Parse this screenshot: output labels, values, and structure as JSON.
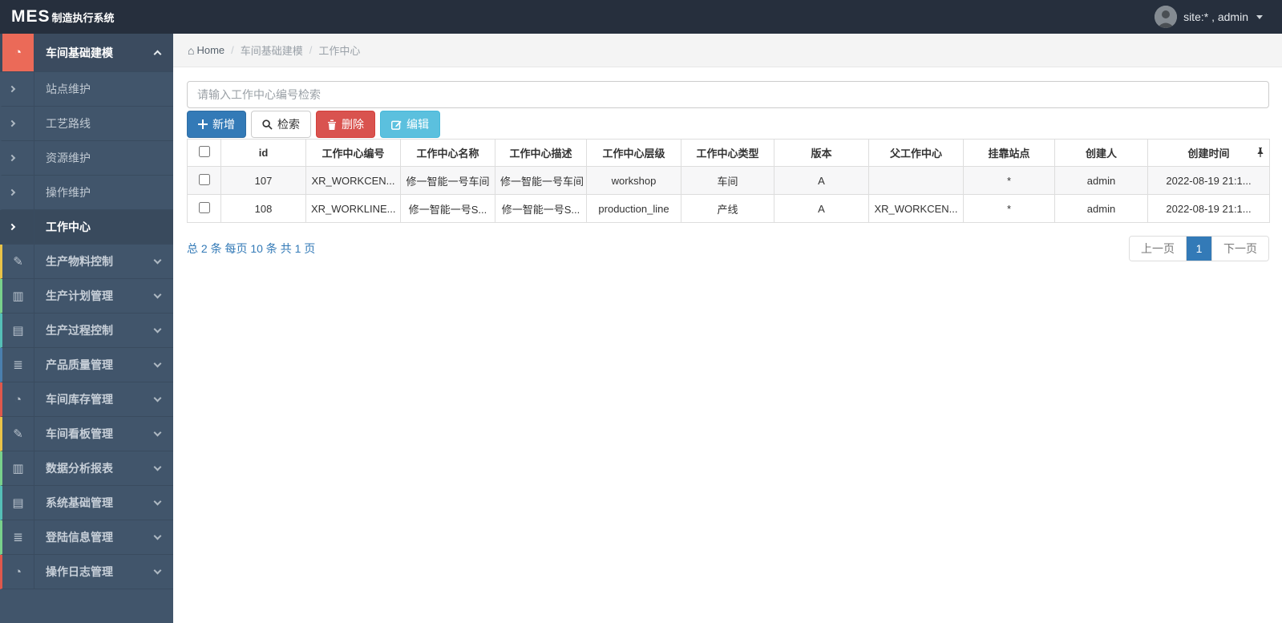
{
  "topbar": {
    "logo_primary": "MES",
    "logo_secondary": "制造执行系统",
    "user_label": "site:* , admin",
    "avatar_icon": "user-avatar"
  },
  "colors": {
    "topbar_bg": "#262f3d",
    "sidebar_bg": "#41556b",
    "active_icon_bg": "#eb6a58",
    "primary_blue": "#337ab7",
    "danger_red": "#d9534f",
    "info_cyan": "#5bc0de"
  },
  "sidebar": {
    "root_item": {
      "label": "车间基础建模",
      "icon": "gauge-icon",
      "expanded": true
    },
    "sub_items": [
      {
        "label": "站点维护",
        "active": false
      },
      {
        "label": "工艺路线",
        "active": false
      },
      {
        "label": "资源维护",
        "active": false
      },
      {
        "label": "操作维护",
        "active": false
      },
      {
        "label": "工作中心",
        "active": true
      }
    ],
    "items": [
      {
        "label": "生产物料控制",
        "icon": "pencil-icon",
        "accent": "#e9c348"
      },
      {
        "label": "生产计划管理",
        "icon": "columns-icon",
        "accent": "#79d18b"
      },
      {
        "label": "生产过程控制",
        "icon": "book-icon",
        "accent": "#55bfb7"
      },
      {
        "label": "产品质量管理",
        "icon": "list-icon",
        "accent": "#4a7fae"
      },
      {
        "label": "车间库存管理",
        "icon": "gauge-icon",
        "accent": "#df584c"
      },
      {
        "label": "车间看板管理",
        "icon": "pencil-icon",
        "accent": "#e9c348"
      },
      {
        "label": "数据分析报表",
        "icon": "columns-icon",
        "accent": "#79d18b"
      },
      {
        "label": "系统基础管理",
        "icon": "book-icon",
        "accent": "#55bfb7"
      },
      {
        "label": "登陆信息管理",
        "icon": "list-icon",
        "accent": "#79d18b"
      },
      {
        "label": "操作日志管理",
        "icon": "gauge-icon",
        "accent": "#df584c"
      }
    ]
  },
  "breadcrumb": {
    "home": "Home",
    "level1": "车间基础建模",
    "level2": "工作中心",
    "separator": "/"
  },
  "search": {
    "placeholder": "请输入工作中心编号检索",
    "value": ""
  },
  "toolbar": {
    "add_label": "新增",
    "search_label": "检索",
    "delete_label": "删除",
    "edit_label": "编辑"
  },
  "table": {
    "columns": [
      "id",
      "工作中心编号",
      "工作中心名称",
      "工作中心描述",
      "工作中心层级",
      "工作中心类型",
      "版本",
      "父工作中心",
      "挂靠站点",
      "创建人",
      "创建时间"
    ],
    "rows": [
      {
        "id": "107",
        "code": "XR_WORKCEN...",
        "name": "修一智能一号车间",
        "desc": "修一智能一号车间",
        "level": "workshop",
        "type": "车间",
        "version": "A",
        "parent": "",
        "station": "*",
        "creator": "admin",
        "created": "2022-08-19 21:1..."
      },
      {
        "id": "108",
        "code": "XR_WORKLINE...",
        "name": "修一智能一号S...",
        "desc": "修一智能一号S...",
        "level": "production_line",
        "type": "产线",
        "version": "A",
        "parent": "XR_WORKCEN...",
        "station": "*",
        "creator": "admin",
        "created": "2022-08-19 21:1..."
      }
    ]
  },
  "pagination": {
    "summary": "总 2 条  每页 10 条  共 1 页",
    "prev_label": "上一页",
    "current_page": "1",
    "next_label": "下一页"
  }
}
